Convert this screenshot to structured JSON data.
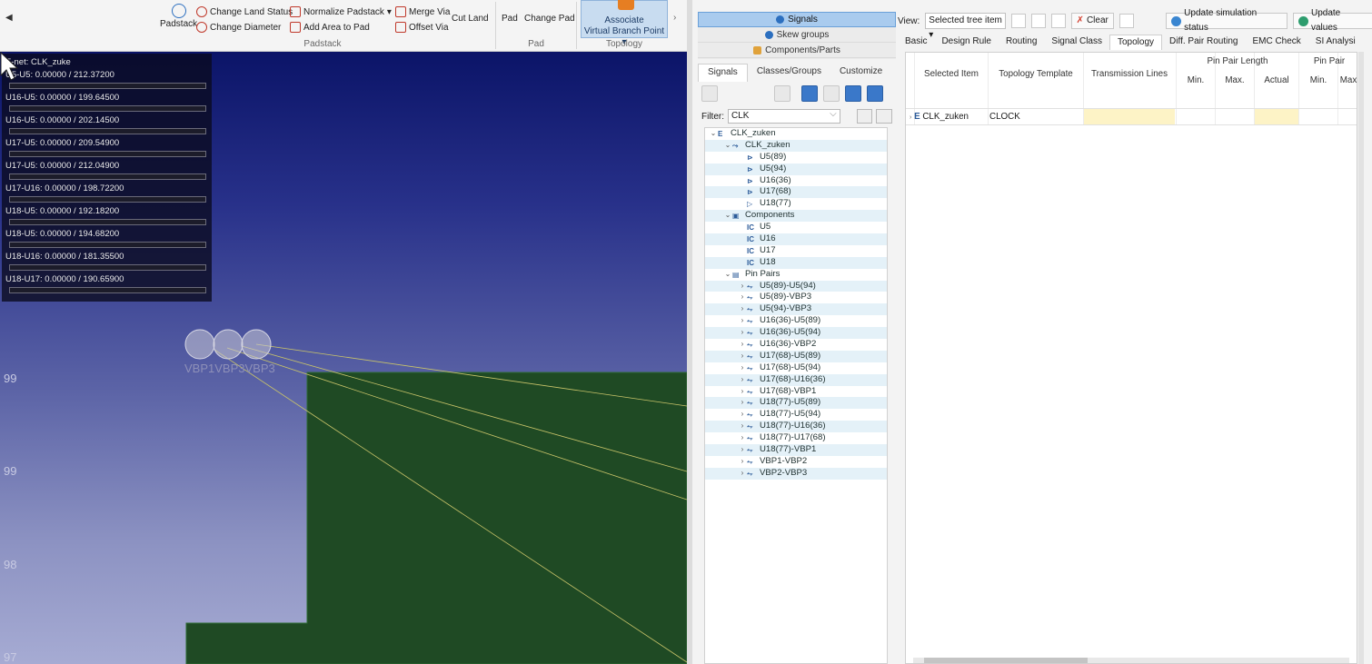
{
  "ribbon": {
    "padstack_label": "Padstack",
    "change_land_status": "Change Land Status",
    "change_diameter": "Change Diameter",
    "normalize_padstack": "Normalize Padstack",
    "add_area_to_pad": "Add Area to Pad",
    "merge_via": "Merge Via",
    "offset_via": "Offset Via",
    "cut_land": "Cut Land",
    "pad": "Pad",
    "change_pad": "Change Pad",
    "associate": "Associate",
    "virtual_branch_point": "Virtual Branch Point",
    "group_padstack": "Padstack",
    "group_pad": "Pad",
    "group_topology": "Topology"
  },
  "canvas": {
    "enet_title": "E-net: CLK_zuke",
    "pin_pairs": [
      "U5-U5: 0.00000 / 212.37200",
      "U16-U5: 0.00000 / 199.64500",
      "U16-U5: 0.00000 / 202.14500",
      "U17-U5: 0.00000 / 209.54900",
      "U17-U5: 0.00000 / 212.04900",
      "U17-U16: 0.00000 / 198.72200",
      "U18-U5: 0.00000 / 192.18200",
      "U18-U5: 0.00000 / 194.68200",
      "U18-U16: 0.00000 / 181.35500",
      "U18-U17: 0.00000 / 190.65900"
    ],
    "via_label": "VBP1VBP3VBP3",
    "axis_labels": [
      "99",
      "99",
      "98",
      "97"
    ],
    "colors": {
      "board": "#1f4a24",
      "rats": "#c9c46a"
    }
  },
  "nav": {
    "signals": "Signals",
    "skew_groups": "Skew groups",
    "components_parts": "Components/Parts"
  },
  "subtabs": [
    "Signals",
    "Classes/Groups",
    "Customize"
  ],
  "filter": {
    "label": "Filter:",
    "value": "CLK"
  },
  "tree": [
    {
      "d": 0,
      "t": "⌄",
      "i": "E",
      "l": "CLK_zuken"
    },
    {
      "d": 1,
      "t": "⌄",
      "i": "⤳",
      "l": "CLK_zuken"
    },
    {
      "d": 2,
      "t": "",
      "i": "⊳",
      "l": "U5(89)"
    },
    {
      "d": 2,
      "t": "",
      "i": "⊳",
      "l": "U5(94)"
    },
    {
      "d": 2,
      "t": "",
      "i": "⊳",
      "l": "U16(36)"
    },
    {
      "d": 2,
      "t": "",
      "i": "⊳",
      "l": "U17(68)"
    },
    {
      "d": 2,
      "t": "",
      "i": "▷",
      "l": "U18(77)"
    },
    {
      "d": 1,
      "t": "⌄",
      "i": "▣",
      "l": "Components"
    },
    {
      "d": 2,
      "t": "",
      "i": "IC",
      "l": "U5"
    },
    {
      "d": 2,
      "t": "",
      "i": "IC",
      "l": "U16"
    },
    {
      "d": 2,
      "t": "",
      "i": "IC",
      "l": "U17"
    },
    {
      "d": 2,
      "t": "",
      "i": "IC",
      "l": "U18"
    },
    {
      "d": 1,
      "t": "⌄",
      "i": "▤",
      "l": "Pin Pairs"
    },
    {
      "d": 2,
      "t": "›",
      "i": "⥊",
      "l": "U5(89)-U5(94)"
    },
    {
      "d": 2,
      "t": "›",
      "i": "⥊",
      "l": "U5(89)-VBP3"
    },
    {
      "d": 2,
      "t": "›",
      "i": "⥊",
      "l": "U5(94)-VBP3"
    },
    {
      "d": 2,
      "t": "›",
      "i": "⥊",
      "l": "U16(36)-U5(89)"
    },
    {
      "d": 2,
      "t": "›",
      "i": "⥊",
      "l": "U16(36)-U5(94)"
    },
    {
      "d": 2,
      "t": "›",
      "i": "⥊",
      "l": "U16(36)-VBP2"
    },
    {
      "d": 2,
      "t": "›",
      "i": "⥊",
      "l": "U17(68)-U5(89)"
    },
    {
      "d": 2,
      "t": "›",
      "i": "⥊",
      "l": "U17(68)-U5(94)"
    },
    {
      "d": 2,
      "t": "›",
      "i": "⥊",
      "l": "U17(68)-U16(36)"
    },
    {
      "d": 2,
      "t": "›",
      "i": "⥊",
      "l": "U17(68)-VBP1"
    },
    {
      "d": 2,
      "t": "›",
      "i": "⥊",
      "l": "U18(77)-U5(89)"
    },
    {
      "d": 2,
      "t": "›",
      "i": "⥊",
      "l": "U18(77)-U5(94)"
    },
    {
      "d": 2,
      "t": "›",
      "i": "⥊",
      "l": "U18(77)-U16(36)"
    },
    {
      "d": 2,
      "t": "›",
      "i": "⥊",
      "l": "U18(77)-U17(68)"
    },
    {
      "d": 2,
      "t": "›",
      "i": "⥊",
      "l": "U18(77)-VBP1"
    },
    {
      "d": 2,
      "t": "›",
      "i": "⥊",
      "l": "VBP1-VBP2"
    },
    {
      "d": 2,
      "t": "›",
      "i": "⥊",
      "l": "VBP2-VBP3"
    }
  ],
  "view": {
    "label": "View:",
    "selected": "Selected tree item",
    "clear": "Clear",
    "update_sim": "Update simulation status",
    "update_values": "Update values"
  },
  "main_tabs": [
    "Basic",
    "Design Rule",
    "Routing",
    "Signal Class",
    "Topology",
    "Diff. Pair Routing",
    "EMC Check",
    "SI Analysi"
  ],
  "grid": {
    "headers": {
      "selected_item": "Selected Item",
      "topology_template": "Topology Template",
      "transmission_lines": "Transmission Lines",
      "pin_pair_length": "Pin Pair Length",
      "pin_pair_2": "Pin Pair",
      "min": "Min.",
      "max": "Max.",
      "actual": "Actual",
      "min2": "Min.",
      "max2": "Max"
    },
    "row": {
      "item": "CLK_zuken",
      "template": "CLOCK"
    }
  }
}
